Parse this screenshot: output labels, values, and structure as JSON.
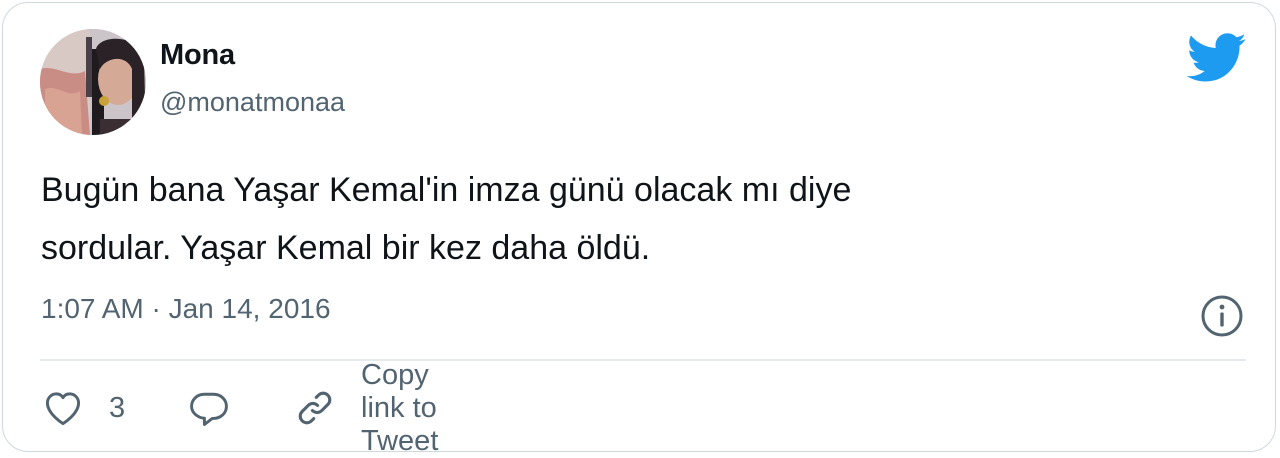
{
  "tweet": {
    "author": {
      "name": "Mona",
      "handle": "@monatmonaa"
    },
    "text": "Bugün bana Yaşar Kemal'in imza günü olacak mı diye\nsordular. Yaşar Kemal bir kez daha öldü.",
    "timestamp": "1:07 AM · Jan 14, 2016",
    "likes_count": "3",
    "copy_link_label": "Copy link to Tweet"
  },
  "icons": {
    "brand": "twitter-bird-icon",
    "info": "info-icon",
    "like": "heart-icon",
    "reply": "reply-bubble-icon",
    "link": "link-icon"
  },
  "colors": {
    "brand": "#1d9bf0",
    "text_primary": "#0f1419",
    "text_secondary": "#536471",
    "border": "#cfd9de"
  }
}
